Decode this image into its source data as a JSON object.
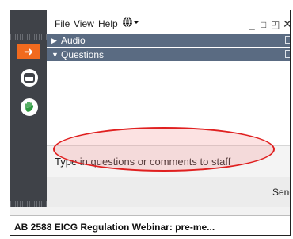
{
  "menu": {
    "file": "File",
    "view": "View",
    "help": "Help"
  },
  "icons": {
    "globe": "globe-icon",
    "minimize": "minimize-icon",
    "restore": "restore-icon",
    "close": "close-icon",
    "popout": "popout-icon",
    "arrow": "arrow-right-icon",
    "screen": "screen-icon",
    "raise_hand": "raise-hand-icon"
  },
  "sections": {
    "audio": "Audio",
    "questions": "Questions"
  },
  "questions": {
    "placeholder": "Type in questions or comments to staff",
    "send_label": "Send"
  },
  "webinar": {
    "title": "AB 2588 EICG Regulation Webinar: pre-me..."
  },
  "colors": {
    "toolbar_bg": "#3f4248",
    "section_bar": "#5a6b82",
    "accent_orange": "#f16a1e",
    "highlight_red": "#e02020"
  }
}
